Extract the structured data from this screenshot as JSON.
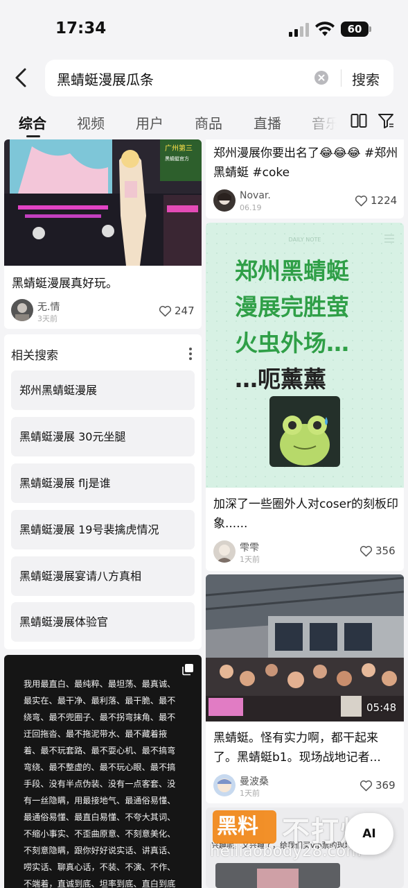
{
  "status_bar": {
    "time": "17:34",
    "battery": "60"
  },
  "search": {
    "query": "黑蜻蜓漫展瓜条",
    "submit_label": "搜索"
  },
  "tabs": [
    {
      "label": "综合"
    },
    {
      "label": "视频"
    },
    {
      "label": "用户"
    },
    {
      "label": "商品"
    },
    {
      "label": "直播"
    },
    {
      "label": "音乐"
    }
  ],
  "left_column": {
    "post1": {
      "title": "黑蜻蜓漫展真好玩。",
      "author": "无.情",
      "time": "3天前",
      "likes": "247",
      "banner_text": "广州第三",
      "banner_sub": "黑蜻蜓官方"
    },
    "related": {
      "title": "相关搜索",
      "items": [
        {
          "label": "郑州黑蜻蜓漫展"
        },
        {
          "label": "黑蜻蜓漫展 30元坐腿"
        },
        {
          "label": "黑蜻蜓漫展 flj是谁"
        },
        {
          "label": "黑蜻蜓漫展 19号裴擒虎情况"
        },
        {
          "label": "黑蜻蜓漫展宴请八方真相"
        },
        {
          "label": "黑蜻蜓漫展体验官"
        }
      ]
    },
    "quote_post": {
      "text": "我用最直白、最纯粹、最坦荡、最真诚、最实在、最干净、最利落、最干脆、最不绕弯、最不兜圈子、最不拐弯抹角、最不迂回拖沓、最不拖泥带水、最不藏着掖着、最不玩套路、最不耍心机、最不搞弯弯绕、最不整虚的、最不玩心眼、最不搞手段、没有半点伪装、没有一点客套、没有一丝隐瞒，用最接地气、最通俗易懂、最通俗易懂、最直白易懂、不夸大其词、不缩小事实、不歪曲原意、不刻意美化、不刻意隐瞒，跟你好好说实话、讲真话、唠实话、聊真心话，不装、不演、不作、不端着，直诚到底、坦率到底、直白到底的方式来告诉你，我没撒谎也跟你是真心，最"
    }
  },
  "right_column": {
    "post2": {
      "title": "郑州漫展你要出名了😂😂😂 #郑州黑蜻蜓 #coke",
      "author": "Novar.",
      "time": "06.19",
      "likes": "1224"
    },
    "post3": {
      "note_header": "DAILY NOTE",
      "note_lines": [
        "郑州黑蜻蜓",
        "漫展完胜萤",
        "火虫外场…",
        "…呃薰薰"
      ],
      "title": "加深了一些圈外人对coser的刻板印象......",
      "author": "雫雫",
      "time": "1天前",
      "likes": "356"
    },
    "post4": {
      "duration": "05:48",
      "title": "黑蜻蜓。怪有实力啊，都干起来了。黑蜻蜓b1。现场战地记者...",
      "author": "曼波桑",
      "time": "1天前",
      "likes": "369"
    },
    "post5": {
      "partial_text": "兴趣呢，又兴趣了，给我们买vip票的现场"
    }
  },
  "watermark": {
    "logo_text": "黑料",
    "text": "不打烊",
    "url": "heiliaobody28.com"
  },
  "ai_button": {
    "label": "AI"
  },
  "colors": {
    "accent_green": "#2f9f47",
    "note_bg": "#d7f1e4",
    "dark_card": "#151515"
  }
}
